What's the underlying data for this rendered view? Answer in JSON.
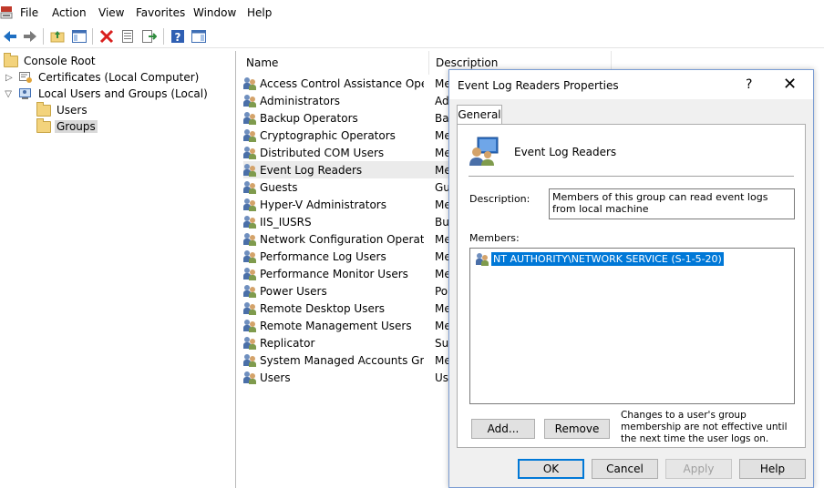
{
  "menu": {
    "items": [
      "File",
      "Action",
      "View",
      "Favorites",
      "Window",
      "Help"
    ]
  },
  "toolbar": {
    "buttons": [
      "back-arrow-icon",
      "forward-arrow-icon",
      "up-folder-icon",
      "show-hide-tree-icon",
      "delete-icon",
      "properties-icon",
      "export-list-icon",
      "help-icon",
      "action-pane-icon"
    ]
  },
  "tree": {
    "root": "Console Root",
    "items": [
      {
        "label": "Certificates (Local Computer)"
      },
      {
        "label": "Local Users and Groups (Local)"
      },
      {
        "label": "Users"
      },
      {
        "label": "Groups"
      }
    ]
  },
  "list": {
    "columns": [
      "Name",
      "Description"
    ],
    "rows": [
      {
        "name": "Access Control Assistance Opera...",
        "desc": "Me"
      },
      {
        "name": "Administrators",
        "desc": "Ad"
      },
      {
        "name": "Backup Operators",
        "desc": "Bac"
      },
      {
        "name": "Cryptographic Operators",
        "desc": "Me"
      },
      {
        "name": "Distributed COM Users",
        "desc": "Me"
      },
      {
        "name": "Event Log Readers",
        "desc": "Me"
      },
      {
        "name": "Guests",
        "desc": "Gu"
      },
      {
        "name": "Hyper-V Administrators",
        "desc": "Me"
      },
      {
        "name": "IIS_IUSRS",
        "desc": "Bu"
      },
      {
        "name": "Network Configuration Operators",
        "desc": "Me"
      },
      {
        "name": "Performance Log Users",
        "desc": "Me"
      },
      {
        "name": "Performance Monitor Users",
        "desc": "Me"
      },
      {
        "name": "Power Users",
        "desc": "Po"
      },
      {
        "name": "Remote Desktop Users",
        "desc": "Me"
      },
      {
        "name": "Remote Management Users",
        "desc": "Me"
      },
      {
        "name": "Replicator",
        "desc": "Sup"
      },
      {
        "name": "System Managed Accounts Group",
        "desc": "Me"
      },
      {
        "name": "Users",
        "desc": "Use"
      }
    ]
  },
  "dialog": {
    "title": "Event Log Readers Properties",
    "help_glyph": "?",
    "close_glyph": "✕",
    "tab": "General",
    "group_name": "Event Log Readers",
    "description_label": "Description:",
    "description_value": "Members of this group can read event logs from local machine",
    "members_label": "Members:",
    "members": [
      "NT AUTHORITY\\NETWORK SERVICE (S-1-5-20)"
    ],
    "add_label": "Add...",
    "remove_label": "Remove",
    "note": "Changes to a user's group membership are not effective until the next time the user logs on.",
    "ok_label": "OK",
    "cancel_label": "Cancel",
    "apply_label": "Apply",
    "help_label": "Help"
  },
  "colors": {
    "selection": "#0078d7",
    "dialog_border": "#7a9cd3"
  }
}
